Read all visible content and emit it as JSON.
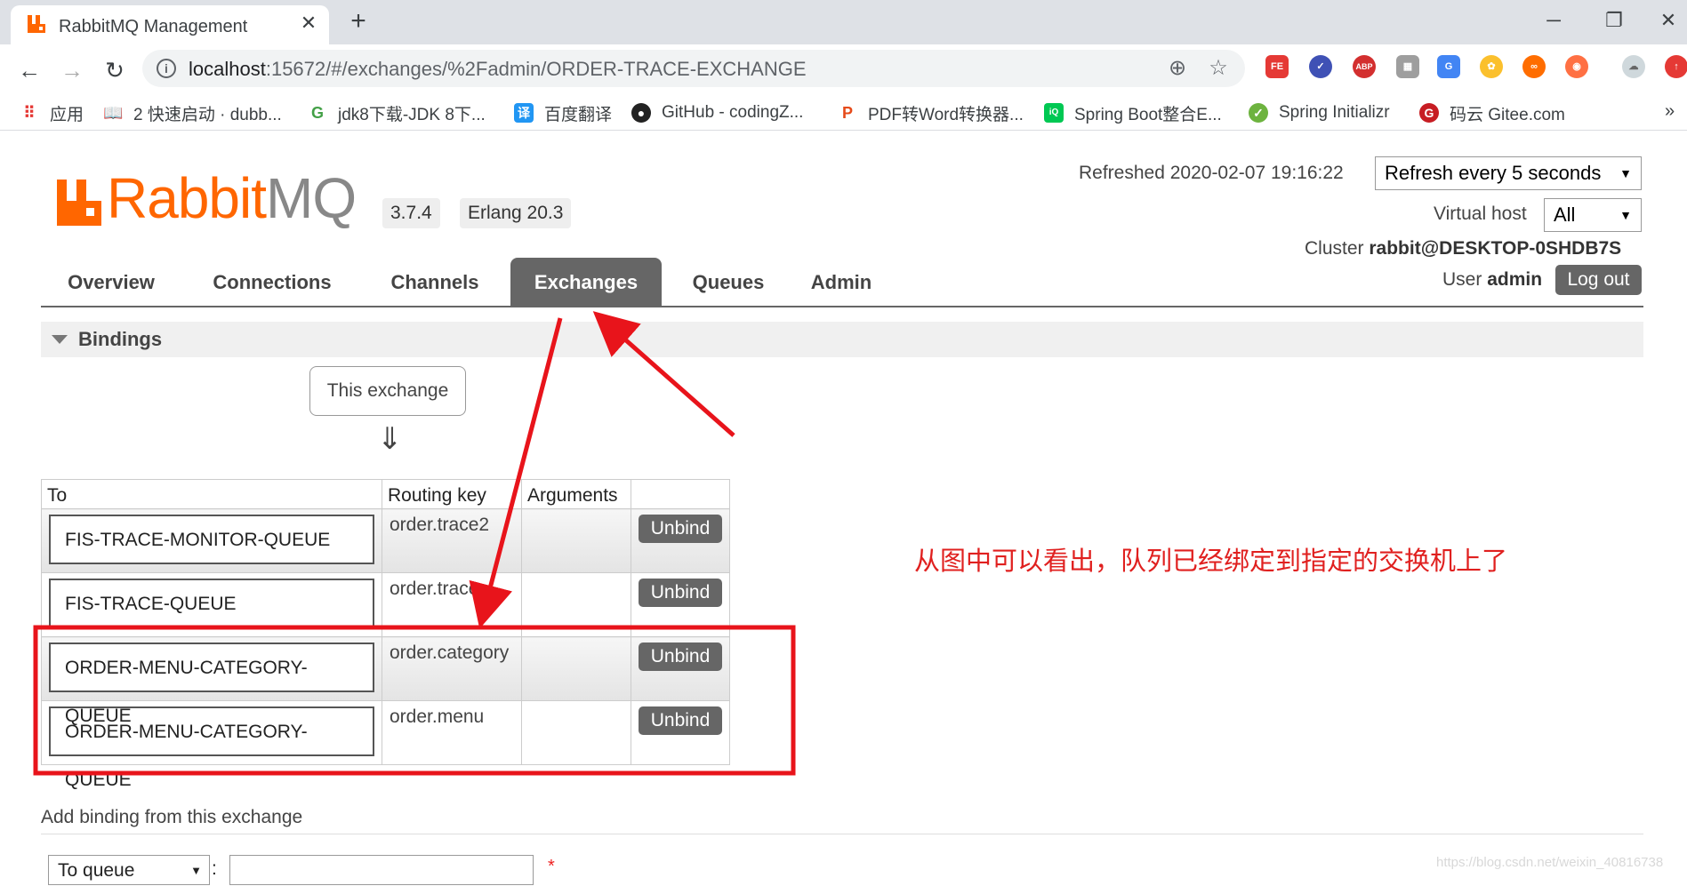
{
  "browser": {
    "tab_title": "RabbitMQ Management",
    "tab_close": "✕",
    "new_tab": "+",
    "url_host": "localhost",
    "url_rest": ":15672/#/exchanges/%2Fadmin/ORDER-TRACE-EXCHANGE",
    "bookmarks": [
      {
        "label": "应用",
        "icon": "apps-grid-icon"
      },
      {
        "label": "2 快速启动 · dubb...",
        "icon": "book-icon"
      },
      {
        "label": "jdk8下载-JDK 8下...",
        "icon": "leaf-icon"
      },
      {
        "label": "百度翻译",
        "icon": "translate-icon"
      },
      {
        "label": "GitHub - codingZ...",
        "icon": "github-icon"
      },
      {
        "label": "PDF转Word转换器...",
        "icon": "pdf-icon"
      },
      {
        "label": "Spring Boot整合E...",
        "icon": "iqiyi-icon"
      },
      {
        "label": "Spring Initializr",
        "icon": "spring-icon"
      },
      {
        "label": "码云 Gitee.com",
        "icon": "gitee-icon"
      }
    ],
    "bookmarks_more": "»"
  },
  "app": {
    "logo_rabbit": "Rabbit",
    "logo_mq": "MQ",
    "version": "3.7.4",
    "erlang": "Erlang 20.3",
    "refreshed": "Refreshed 2020-02-07 19:16:22",
    "refresh_option": "Refresh every 5 seconds",
    "virtual_host_label": "Virtual host",
    "virtual_host_value": "All",
    "cluster_label": "Cluster",
    "cluster_value": "rabbit@DESKTOP-0SHDB7S",
    "user_label": "User",
    "user_value": "admin",
    "logout": "Log out",
    "nav": [
      "Overview",
      "Connections",
      "Channels",
      "Exchanges",
      "Queues",
      "Admin"
    ],
    "active_nav": "Exchanges"
  },
  "bindings": {
    "section_title": "Bindings",
    "this_exchange": "This exchange",
    "down_arrow": "⇓",
    "columns": [
      "To",
      "Routing key",
      "Arguments",
      ""
    ],
    "rows": [
      {
        "to": "FIS-TRACE-MONITOR-QUEUE",
        "routing_key": "order.trace2",
        "arguments": "",
        "action": "Unbind"
      },
      {
        "to": "FIS-TRACE-QUEUE",
        "routing_key": "order.trace",
        "arguments": "",
        "action": "Unbind"
      },
      {
        "to": "ORDER-MENU-CATEGORY-QUEUE",
        "routing_key": "order.category",
        "arguments": "",
        "action": "Unbind"
      },
      {
        "to": "ORDER-MENU-CATEGORY-QUEUE",
        "routing_key": "order.menu",
        "arguments": "",
        "action": "Unbind"
      }
    ]
  },
  "annotation": {
    "text": "从图中可以看出，队列已经绑定到指定的交换机上了",
    "color": "#e0201f"
  },
  "add_binding": {
    "title": "Add binding from this exchange",
    "destination_type": "To queue",
    "colon": ":",
    "required_mark": "*"
  },
  "watermark": "https://blog.csdn.net/weixin_40816738"
}
